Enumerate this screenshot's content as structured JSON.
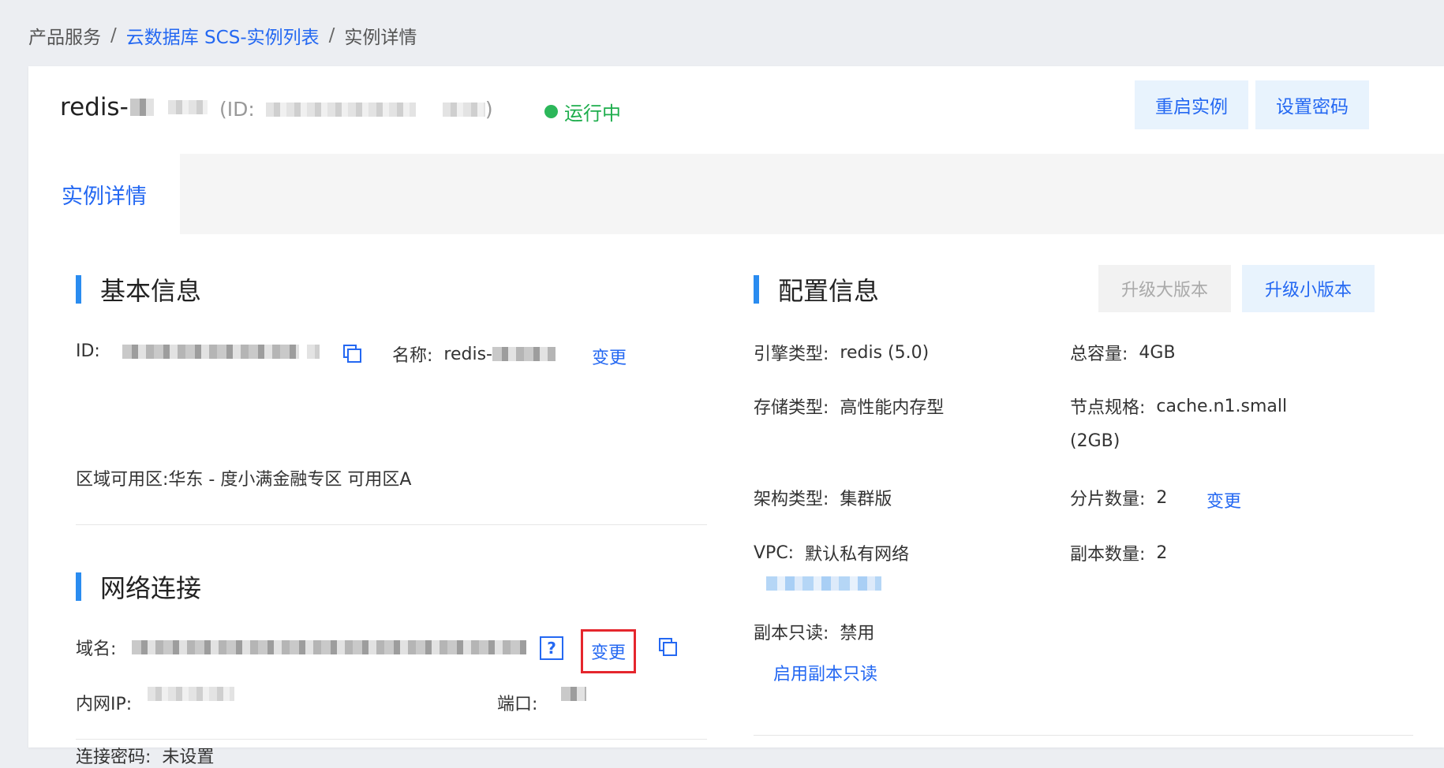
{
  "breadcrumb": {
    "items": [
      "产品服务",
      "云数据库 SCS-实例列表",
      "实例详情"
    ],
    "separator": "/"
  },
  "header": {
    "instance_name_prefix": "redis-",
    "id_label": "(ID:",
    "id_suffix": ")",
    "status": "运行中",
    "buttons": {
      "restart": "重启实例",
      "set_password": "设置密码"
    }
  },
  "tabs": [
    {
      "label": "实例详情",
      "active": true
    }
  ],
  "basic_info": {
    "title": "基本信息",
    "id_label": "ID:",
    "name_label": "名称:",
    "name_prefix": "redis-",
    "change_link": "变更",
    "zone_label": "区域可用区:",
    "zone_value": "华东 - 度小满金融专区 可用区A"
  },
  "network": {
    "title": "网络连接",
    "domain_label": "域名:",
    "help": "?",
    "change_link": "变更",
    "intranet_ip_label": "内网IP:",
    "port_label": "端口:",
    "password_label": "连接密码:",
    "password_value": "未设置"
  },
  "config": {
    "title": "配置信息",
    "upgrade_major": "升级大版本",
    "upgrade_minor": "升级小版本",
    "engine_label": "引擎类型:",
    "engine_value": "redis (5.0)",
    "capacity_label": "总容量:",
    "capacity_value": "4GB",
    "storage_label": "存储类型:",
    "storage_value": "高性能内存型",
    "node_spec_label": "节点规格:",
    "node_spec_value": "cache.n1.small",
    "node_spec_value_2": "(2GB)",
    "arch_label": "架构类型:",
    "arch_value": "集群版",
    "shards_label": "分片数量:",
    "shards_value": "2",
    "shards_change": "变更",
    "vpc_label": "VPC:",
    "vpc_value": "默认私有网络",
    "replicas_label": "副本数量:",
    "replicas_value": "2",
    "readonly_label": "副本只读:",
    "readonly_value": "禁用",
    "enable_readonly": "启用副本只读"
  },
  "colors": {
    "accent": "#2468f2",
    "status_green": "#1dad4c",
    "section_bar": "#2a8cf0",
    "highlight_red": "#e5262d"
  }
}
